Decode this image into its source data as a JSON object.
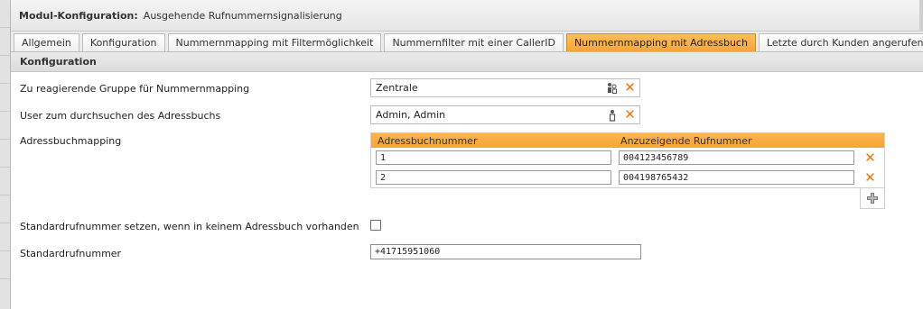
{
  "window": {
    "title_strong": "Modul-Konfiguration:",
    "title_rest": "Ausgehende Rufnummernsignalisierung"
  },
  "tabs": [
    {
      "label": "Allgemein",
      "active": false
    },
    {
      "label": "Konfiguration",
      "active": false
    },
    {
      "label": "Nummernmapping mit Filtermöglichkeit",
      "active": false
    },
    {
      "label": "Nummernfilter mit einer CallerID",
      "active": false
    },
    {
      "label": "Nummernmapping mit Adressbuch",
      "active": true
    },
    {
      "label": "Letzte durch Kunden angerufen",
      "active": false
    }
  ],
  "section": {
    "title": "Konfiguration"
  },
  "form": {
    "group_label": "Zu reagierende Gruppe für Nummernmapping",
    "group_value": "Zentrale",
    "user_label": "User zum durchsuchen des Adressbuchs",
    "user_value": "Admin, Admin",
    "mapping_label": "Adressbuchmapping",
    "mapping_columns": [
      "Adressbuchnummer",
      "Anzuzeigende Rufnummer"
    ],
    "mapping_rows": [
      {
        "adressbuch": "1",
        "rufnummer": "004123456789"
      },
      {
        "adressbuch": "2",
        "rufnummer": "004198765432"
      }
    ],
    "standard_checkbox_label": "Standardrufnummer setzen, wenn in keinem Adressbuch vorhanden",
    "standard_checkbox_checked": false,
    "standard_number_label": "Standardrufnummer",
    "standard_number_value": "+41715951060"
  },
  "colors": {
    "accent": "#f7a43a",
    "remove_icon": "#e87a10"
  },
  "icons": {
    "group": "group-user-icon",
    "user": "user-icon",
    "remove": "remove-x-icon",
    "add": "add-plus-icon"
  }
}
